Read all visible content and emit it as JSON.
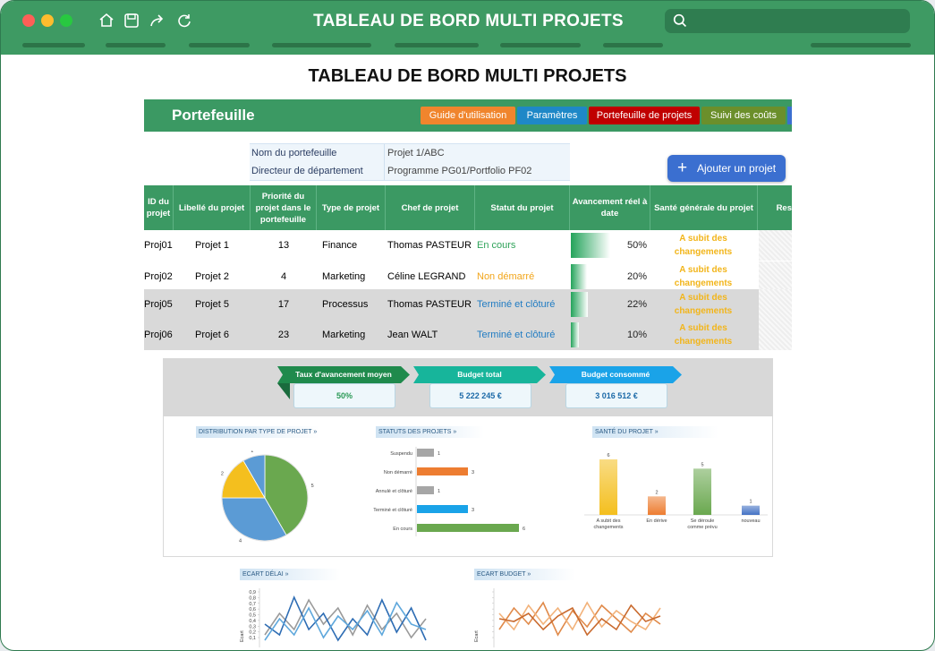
{
  "window": {
    "title": "TABLEAU DE BORD MULTI PROJETS",
    "search_placeholder": ""
  },
  "page_title": "TABLEAU DE BORD MULTI PROJETS",
  "sheet": {
    "title": "Portefeuille",
    "nav": [
      {
        "label": "Guide d'utilisation",
        "color": "#f0852d"
      },
      {
        "label": "Paramètres",
        "color": "#1e88c7"
      },
      {
        "label": "Portefeuille de projets",
        "color": "#c00000"
      },
      {
        "label": "Suivi des coûts",
        "color": "#6b8f2b"
      }
    ],
    "info": [
      {
        "key": "Nom du portefeuille",
        "value": "Projet 1/ABC"
      },
      {
        "key": "Directeur de département",
        "value": "Programme PG01/Portfolio PF02"
      }
    ],
    "add_button": "Ajouter un projet",
    "columns": [
      "ID du projet",
      "Libellé du projet",
      "Priorité du projet dans le portefeuille",
      "Type de projet",
      "Chef de projet",
      "Statut du projet",
      "Avancement réel à date",
      "Santé générale du projet",
      "Res"
    ],
    "rows": [
      {
        "id": "Proj01",
        "label": "Projet 1",
        "priority": "13",
        "type": "Finance",
        "manager": "Thomas PASTEUR",
        "status": "En cours",
        "status_color": "#2fa35a",
        "progress": 50,
        "progress_label": "50%",
        "health": "A subit des changements"
      },
      {
        "id": "Proj02",
        "label": "Projet 2",
        "priority": "4",
        "type": "Marketing",
        "manager": "Céline LEGRAND",
        "status": "Non démarré",
        "status_color": "#f2a51a",
        "progress": 20,
        "progress_label": "20%",
        "health": "A subit des changements"
      },
      {
        "id": "Proj05",
        "label": "Projet 5",
        "priority": "17",
        "type": "Processus",
        "manager": "Thomas PASTEUR",
        "status": "Terminé et clôturé",
        "status_color": "#1f7bc2",
        "progress": 22,
        "progress_label": "22%",
        "health": "A subit des changements"
      },
      {
        "id": "Proj06",
        "label": "Projet 6",
        "priority": "23",
        "type": "Marketing",
        "manager": "Jean WALT",
        "status": "Terminé et clôturé",
        "status_color": "#1f7bc2",
        "progress": 10,
        "progress_label": "10%",
        "health": "A subit des changements"
      }
    ]
  },
  "kpis": [
    {
      "label": "Taux d'avancement moyen",
      "value": "50%",
      "color": "#1f8a4c",
      "value_color": "#2b9a57"
    },
    {
      "label": "Budget total",
      "value": "5 222 245 €",
      "color": "#17b59b",
      "value_color": "#1c6aa8"
    },
    {
      "label": "Budget consommé",
      "value": "3 016 512 €",
      "color": "#1aa3e8",
      "value_color": "#1c6aa8"
    }
  ],
  "charts": {
    "pie": {
      "title": "DISTRIBUTION PAR TYPE DE PROJET »",
      "slices": [
        {
          "value": 5,
          "label": "5",
          "color": "#6aa84f"
        },
        {
          "value": 4,
          "label": "4",
          "color": "#5b9bd5"
        },
        {
          "value": 2,
          "label": "2",
          "color": "#f4bf1e"
        },
        {
          "value": 1,
          "label": "1",
          "color": "#5b9bd5"
        }
      ]
    },
    "status": {
      "title": "STATUTS DES PROJETS »",
      "bars": [
        {
          "label": "Suspendu",
          "value": 1,
          "color": "#a6a6a6"
        },
        {
          "label": "Non démarré",
          "value": 3,
          "color": "#ed7d31"
        },
        {
          "label": "Annulé et clôturé",
          "value": 1,
          "color": "#a6a6a6"
        },
        {
          "label": "Terminé et clôturé",
          "value": 3,
          "color": "#1aa3e8"
        },
        {
          "label": "En cours",
          "value": 6,
          "color": "#6aa84f"
        }
      ]
    },
    "health": {
      "title": "SANTÉ DU PROJET »",
      "bars": [
        {
          "label": "A subit des changements",
          "value": 6,
          "color": "#f4bf1e"
        },
        {
          "label": "En dérive",
          "value": 2,
          "color": "#ed7d31"
        },
        {
          "label": "Se déroule comme prévu",
          "value": 5,
          "color": "#6aa84f"
        },
        {
          "label": "nouveau",
          "value": 1,
          "color": "#4472c4"
        }
      ]
    },
    "delay": {
      "title": "ECART DÉLAI »",
      "yticks": [
        "0,9",
        "0,8",
        "0,7",
        "0,6",
        "0,5",
        "0,4",
        "0,3",
        "0,2",
        "0,1"
      ],
      "ylabel": "Ecart",
      "series": [
        {
          "color": "#9a9a9a",
          "values": [
            0.2,
            0.6,
            0.3,
            0.85,
            0.4,
            0.7,
            0.2,
            0.75,
            0.3,
            0.6,
            0.15,
            0.5
          ]
        },
        {
          "color": "#2e6db4",
          "values": [
            0.4,
            0.2,
            0.9,
            0.3,
            0.6,
            0.1,
            0.5,
            0.2,
            0.85,
            0.25,
            0.7,
            0.1
          ]
        },
        {
          "color": "#5fa8dc",
          "values": [
            0.1,
            0.5,
            0.2,
            0.7,
            0.15,
            0.55,
            0.3,
            0.65,
            0.2,
            0.8,
            0.4,
            0.3
          ]
        }
      ]
    },
    "budget": {
      "title": "ECART BUDGET »",
      "yticks": [
        "",
        "",
        "",
        "",
        "",
        "",
        "",
        "",
        ""
      ],
      "ylabel": "Ecart",
      "series": [
        {
          "color": "#e08a4a",
          "values": [
            0.3,
            0.7,
            0.4,
            0.8,
            0.2,
            0.65,
            0.35,
            0.75,
            0.5,
            0.25,
            0.6,
            0.4
          ]
        },
        {
          "color": "#f2b27a",
          "values": [
            0.6,
            0.3,
            0.75,
            0.4,
            0.7,
            0.3,
            0.8,
            0.35,
            0.65,
            0.45,
            0.3,
            0.7
          ]
        },
        {
          "color": "#c96a2e",
          "values": [
            0.5,
            0.45,
            0.6,
            0.3,
            0.55,
            0.7,
            0.2,
            0.5,
            0.3,
            0.75,
            0.45,
            0.55
          ]
        }
      ]
    }
  }
}
